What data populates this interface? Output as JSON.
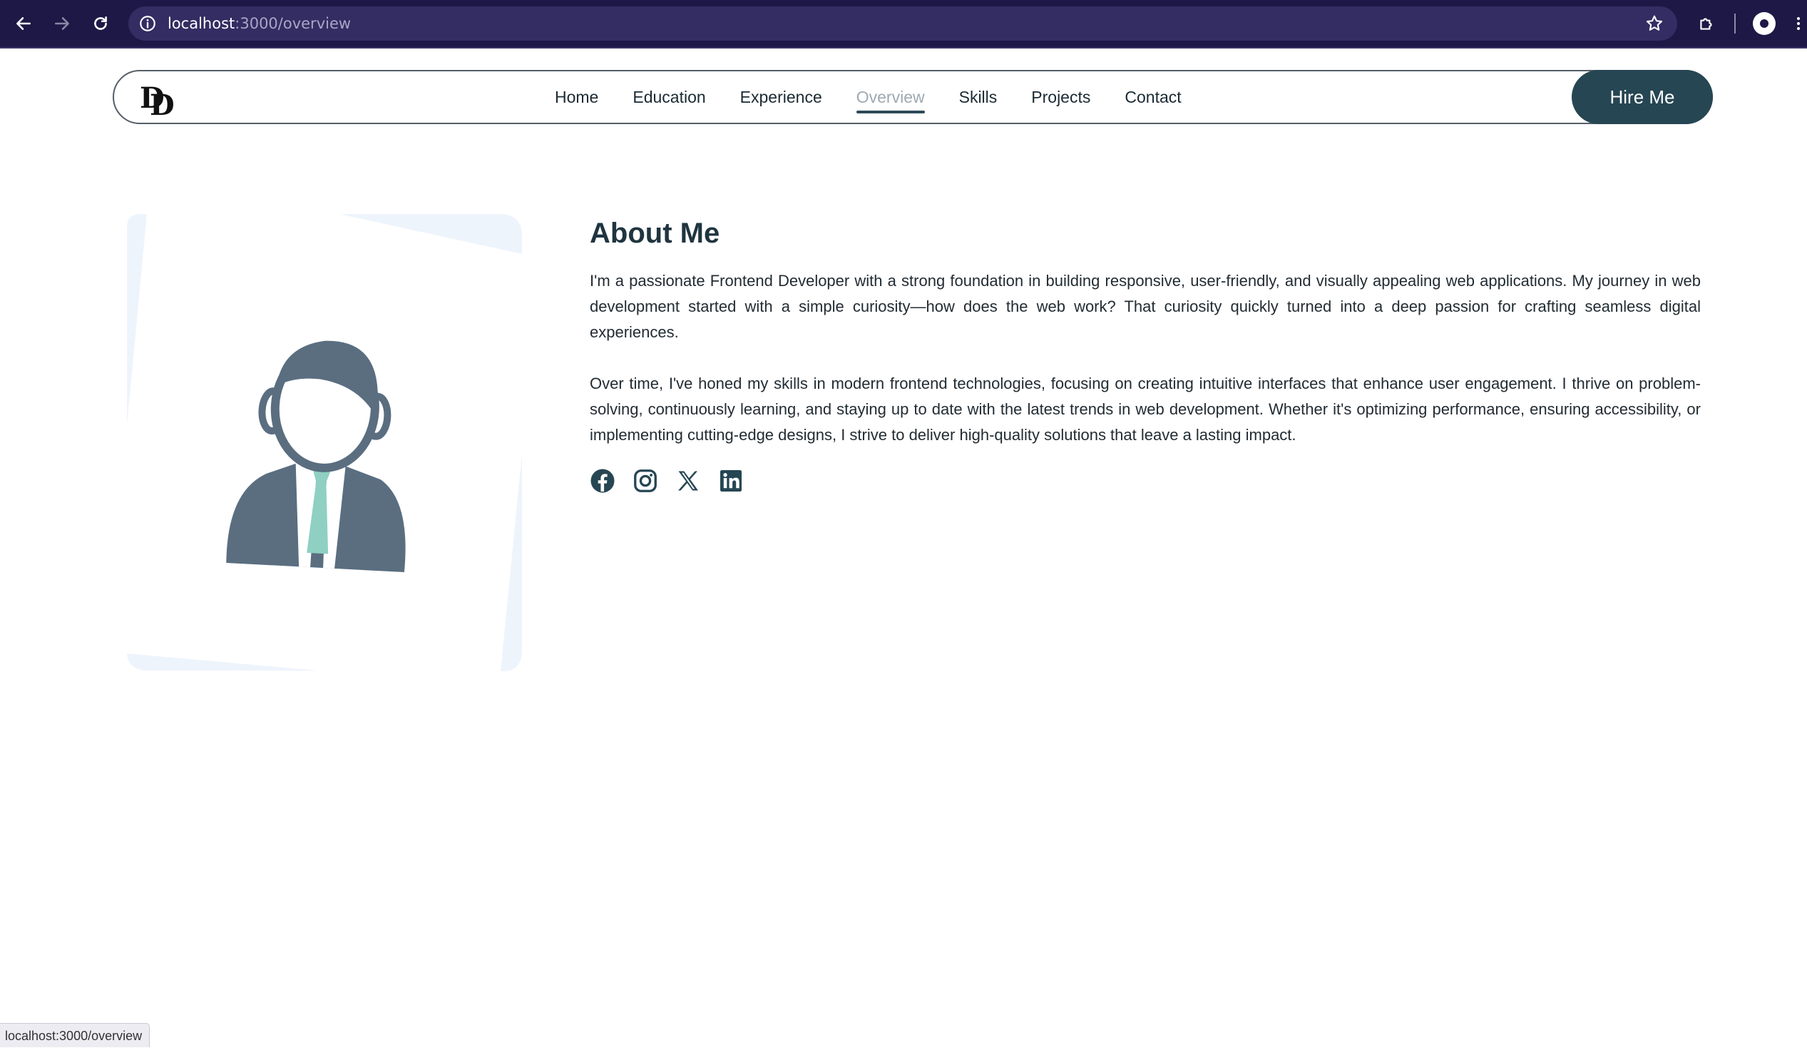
{
  "browser": {
    "url_host": "localhost",
    "url_path": ":3000/overview",
    "status_url": "localhost:3000/overview",
    "icons": {
      "back": "arrow-left-icon",
      "forward": "arrow-right-icon",
      "reload": "reload-icon",
      "info": "info-icon",
      "bookmark": "star-icon",
      "extensions": "puzzle-icon",
      "profile": "profile-avatar-icon",
      "menu": "kebab-menu-icon"
    }
  },
  "navbar": {
    "logo_letters": [
      "D",
      "D"
    ],
    "links": [
      {
        "label": "Home",
        "active": false
      },
      {
        "label": "Education",
        "active": false
      },
      {
        "label": "Experience",
        "active": false
      },
      {
        "label": "Overview",
        "active": true
      },
      {
        "label": "Skills",
        "active": false
      },
      {
        "label": "Projects",
        "active": false
      },
      {
        "label": "Contact",
        "active": false
      }
    ],
    "cta_label": "Hire Me"
  },
  "about": {
    "heading": "About Me",
    "paragraphs": [
      "I'm a passionate Frontend Developer with a strong foundation in building responsive, user-friendly, and visually appealing web applications. My journey in web development started with a simple curiosity—how does the web work? That curiosity quickly turned into a deep passion for crafting seamless digital experiences.",
      "Over time, I've honed my skills in modern frontend technologies, focusing on creating intuitive interfaces that enhance user engagement. I thrive on problem-solving, continuously learning, and staying up to date with the latest trends in web development. Whether it's optimizing performance, ensuring accessibility, or implementing cutting-edge designs, I strive to deliver high-quality solutions that leave a lasting impact."
    ],
    "socials": [
      "facebook-icon",
      "instagram-icon",
      "x-twitter-icon",
      "linkedin-icon"
    ]
  },
  "colors": {
    "chrome_bg": "#1d1846",
    "accent": "#264653",
    "avatar_main": "#5a6e80",
    "tie": "#8fd0c3",
    "card_tint": "#eef4fc"
  }
}
